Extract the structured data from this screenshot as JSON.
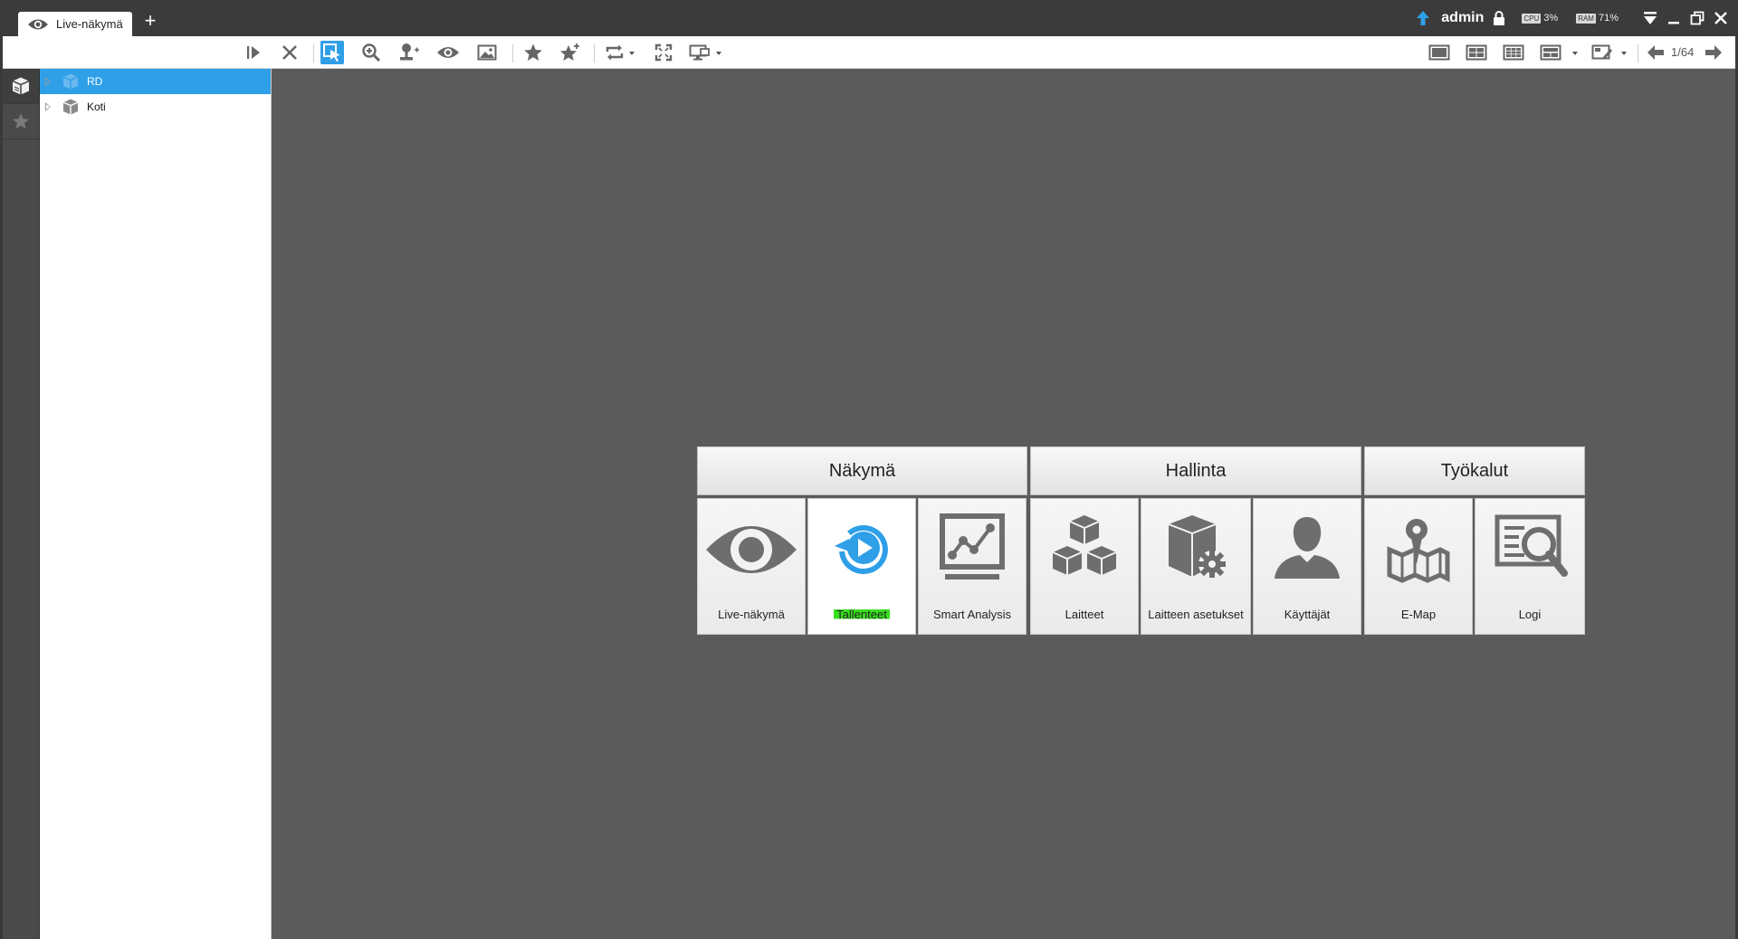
{
  "titlebar": {
    "tab_label": "Live-näkymä",
    "add_tab": "+",
    "user": "admin",
    "cpu_label": "CPU",
    "cpu_value": "3%",
    "ram_label": "RAM",
    "ram_value": "71%"
  },
  "toolbar": {
    "page": "1/64"
  },
  "tree": {
    "items": [
      {
        "label": "RD",
        "selected": true
      },
      {
        "label": "Koti",
        "selected": false
      }
    ]
  },
  "menu": {
    "categories": [
      "Näkymä",
      "Hallinta",
      "Työkalut"
    ],
    "tiles": [
      {
        "label": "Live-näkymä",
        "icon": "eye-icon"
      },
      {
        "label": "Tallenteet",
        "icon": "playback-icon"
      },
      {
        "label": "Smart Analysis",
        "icon": "analysis-chart-icon"
      },
      {
        "label": "Laitteet",
        "icon": "devices-cubes-icon"
      },
      {
        "label": "Laitteen asetukset",
        "icon": "device-settings-icon"
      },
      {
        "label": "Käyttäjät",
        "icon": "user-icon"
      },
      {
        "label": "E-Map",
        "icon": "map-pin-icon"
      },
      {
        "label": "Logi",
        "icon": "log-search-icon"
      }
    ]
  },
  "colors": {
    "accent": "#2f9fe8",
    "highlight": "#39e01f",
    "main_bg": "#5b5b5b",
    "titlebar_bg": "#3b3b3b"
  }
}
